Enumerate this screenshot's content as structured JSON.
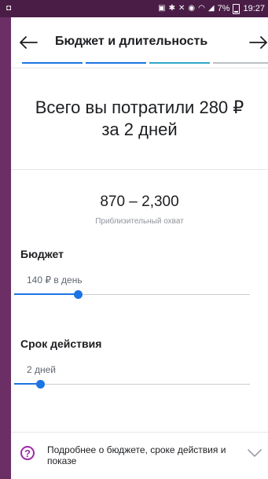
{
  "status_bar": {
    "battery": "7%",
    "time": "19:27"
  },
  "header": {
    "title": "Бюджет и длительность"
  },
  "summary": {
    "line1": "Всего вы потратили 280 ₽",
    "line2": "за 2 дней"
  },
  "reach": {
    "range": "870 – 2,300",
    "caption": "Приблизительный охват"
  },
  "budget": {
    "title": "Бюджет",
    "value": "140 ₽ в день",
    "slider_level": 0.27
  },
  "duration": {
    "title": "Срок действия",
    "value": "2 дней",
    "slider_level": 0.11
  },
  "footer": {
    "text": "Подробнее о бюджете, сроке действия и показе"
  },
  "colors": {
    "accent": "#1b74e4",
    "help_icon": "#9b2aa6",
    "background": "#6b2f66"
  }
}
